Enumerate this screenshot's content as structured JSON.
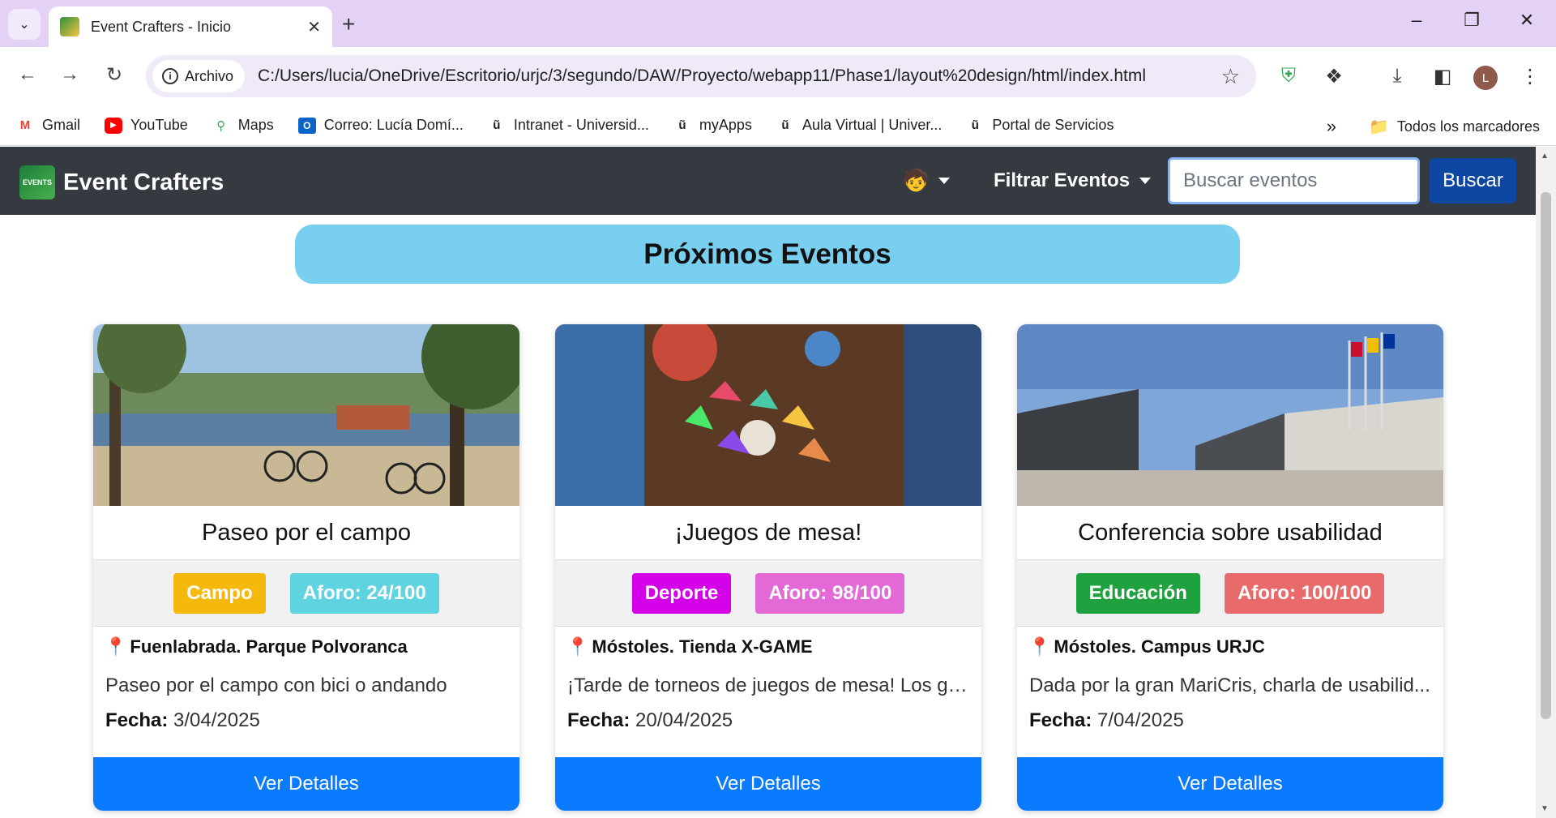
{
  "browser": {
    "tab_title": "Event Crafters - Inicio",
    "site_chip": "Archivo",
    "url": "C:/Users/lucia/OneDrive/Escritorio/urjc/3/segundo/DAW/Proyecto/webapp11/Phase1/layout%20design/html/index.html",
    "profile_initial": "L",
    "bookmarks": [
      {
        "label": "Gmail",
        "icon": "gmail-icon"
      },
      {
        "label": "YouTube",
        "icon": "youtube-icon"
      },
      {
        "label": "Maps",
        "icon": "maps-icon"
      },
      {
        "label": "Correo: Lucía Domí...",
        "icon": "outlook-icon"
      },
      {
        "label": "Intranet - Universid...",
        "icon": "urjc-icon"
      },
      {
        "label": "myApps",
        "icon": "urjc-icon"
      },
      {
        "label": "Aula Virtual | Univer...",
        "icon": "urjc-icon"
      },
      {
        "label": "Portal de Servicios",
        "icon": "urjc-icon"
      }
    ],
    "all_bookmarks": "Todos los marcadores"
  },
  "navbar": {
    "brand": "Event Crafters",
    "filter_label": "Filtrar Eventos",
    "search_placeholder": "Buscar eventos",
    "search_button": "Buscar"
  },
  "heading": "Próximos Eventos",
  "cards": [
    {
      "title": "Paseo por el campo",
      "category": "Campo",
      "category_color": "#f5b90e",
      "capacity": "Aforo: 24/100",
      "capacity_color": "#5fd3e0",
      "location": "Fuenlabrada. Parque Polvoranca",
      "description": "Paseo por el campo con bici o andando",
      "date_label": "Fecha:",
      "date": "3/04/2025",
      "button": "Ver Detalles"
    },
    {
      "title": "¡Juegos de mesa!",
      "category": "Deporte",
      "category_color": "#d400e8",
      "capacity": "Aforo: 98/100",
      "capacity_color": "#e269d6",
      "location": "Móstoles. Tienda X-GAME",
      "description": "¡Tarde de torneos de juegos de mesa! Los ga...",
      "date_label": "Fecha:",
      "date": "20/04/2025",
      "button": "Ver Detalles"
    },
    {
      "title": "Conferencia sobre usabilidad",
      "category": "Educación",
      "category_color": "#20a13f",
      "capacity": "Aforo: 100/100",
      "capacity_color": "#e86a6a",
      "location": "Móstoles. Campus URJC",
      "description": "Dada por la gran MariCris, charla de usabilid...",
      "date_label": "Fecha:",
      "date": "7/04/2025",
      "button": "Ver Detalles"
    }
  ]
}
